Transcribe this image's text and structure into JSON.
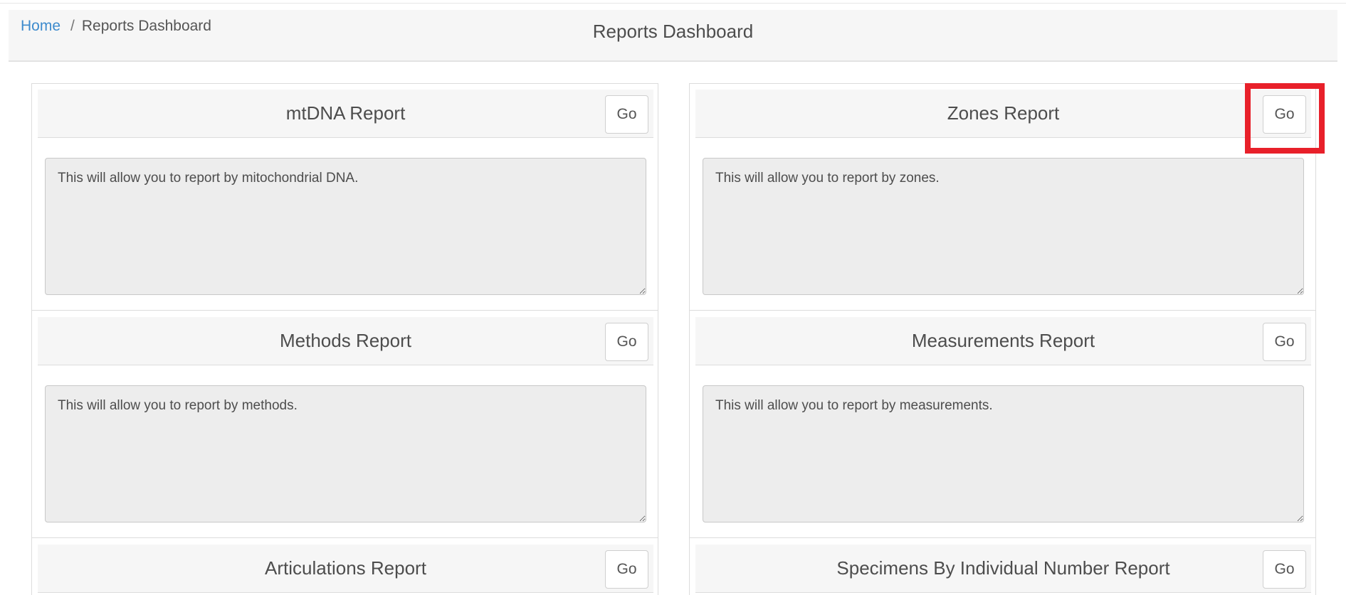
{
  "breadcrumb": {
    "home": "Home",
    "separator": "/",
    "current": "Reports Dashboard"
  },
  "page_title": "Reports Dashboard",
  "reports_left": [
    {
      "title": "mtDNA Report",
      "go_label": "Go",
      "description": "This will allow you to report by mitochondrial DNA."
    },
    {
      "title": "Methods Report",
      "go_label": "Go",
      "description": "This will allow you to report by methods."
    },
    {
      "title": "Articulations Report",
      "go_label": "Go",
      "description": ""
    }
  ],
  "reports_right": [
    {
      "title": "Zones Report",
      "go_label": "Go",
      "description": "This will allow you to report by zones."
    },
    {
      "title": "Measurements Report",
      "go_label": "Go",
      "description": "This will allow you to report by measurements."
    },
    {
      "title": "Specimens By Individual Number Report",
      "go_label": "Go",
      "description": ""
    }
  ],
  "colors": {
    "link": "#3d8bcd",
    "highlight": "#e8202a"
  }
}
